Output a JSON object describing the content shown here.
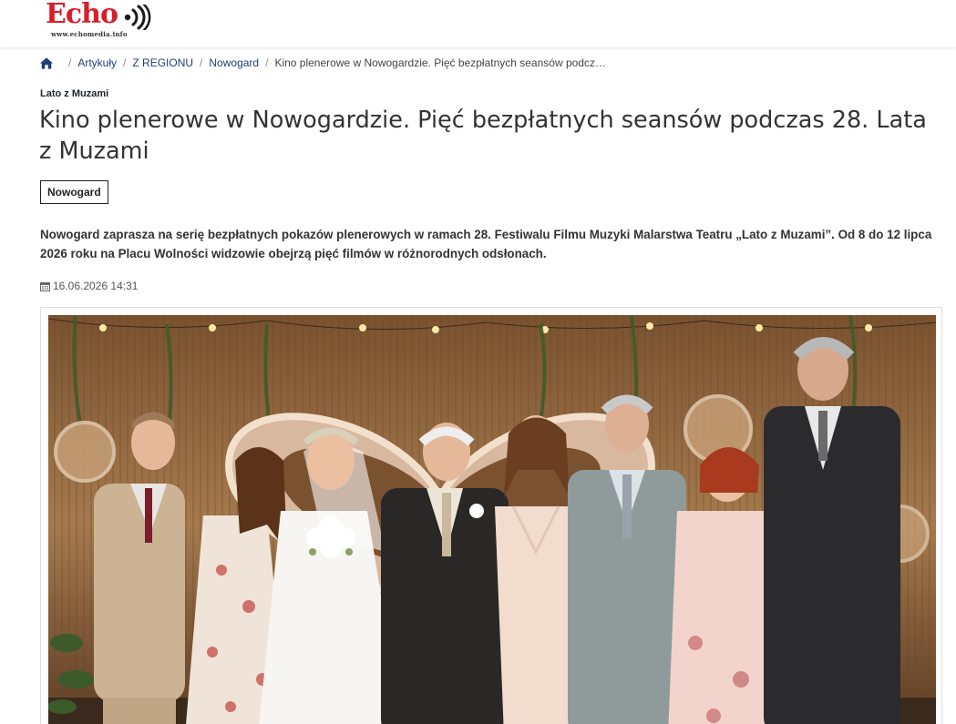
{
  "header": {
    "logo_text": "Echo",
    "logo_url": "www.echomedia.info"
  },
  "breadcrumb": {
    "items": [
      {
        "label": "Artykuły"
      },
      {
        "label": "Z REGIONU"
      },
      {
        "label": "Nowogard"
      }
    ],
    "current": "Kino plenerowe w Nowogardzie. Pięć bezpłatnych seansów podcz…",
    "separator": "/"
  },
  "article": {
    "category": "Lato z Muzami",
    "title": "Kino plenerowe w Nowogardzie. Pięć bezpłatnych seansów podczas 28. Lata z Muzami",
    "tag": "Nowogard",
    "lead": "Nowogard zaprasza na serię bezpłatnych pokazów plenerowych w ramach 28. Festiwalu Filmu Muzyki Malarstwa Teatru „Lato z Muzami”. Od 8 do 12 lipca 2026 roku na Placu Wolności widzowie obejrzą pięć filmów w różnorodnych odsłonach.",
    "date": "16.06.2026 14:31"
  },
  "icons": {
    "home": "home-icon",
    "calendar": "calendar-icon",
    "logo_waves": "sound-waves-icon"
  },
  "colors": {
    "brand_red": "#d81e2a",
    "link_blue": "#1c3f7a"
  }
}
